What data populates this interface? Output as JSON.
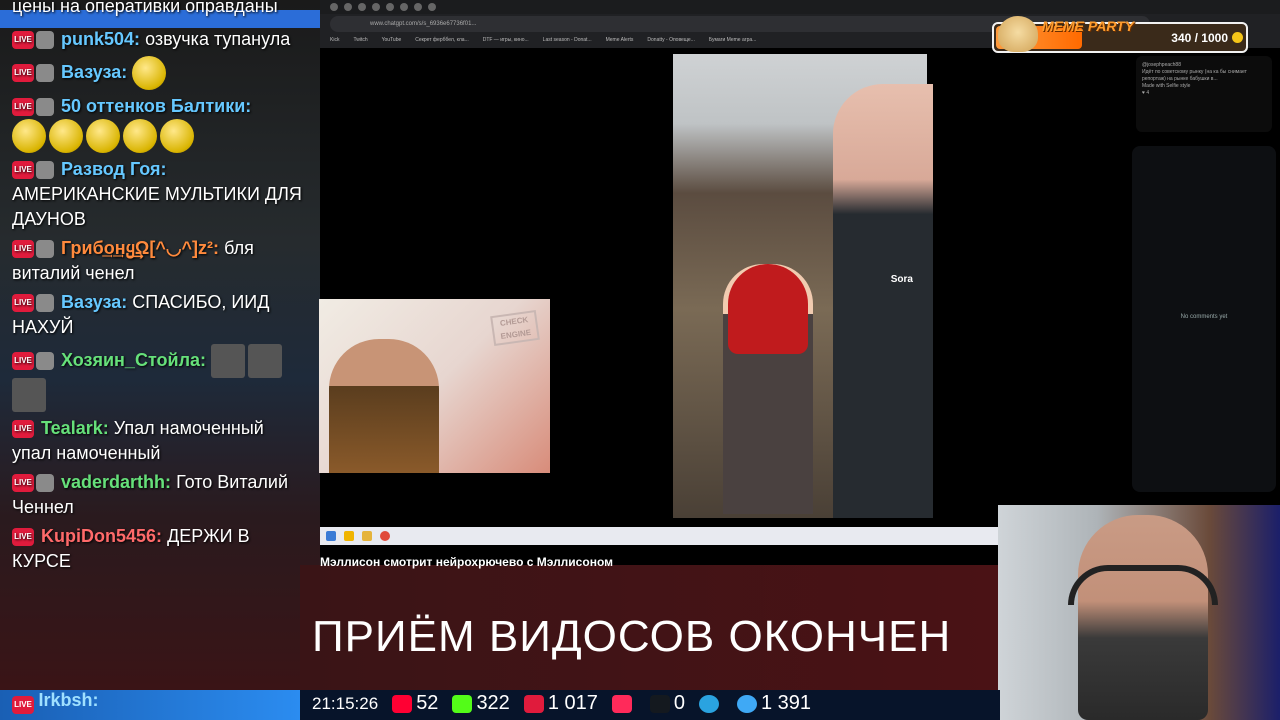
{
  "chat": {
    "messages": [
      {
        "nick": "",
        "text": "цены на оперативки оправданы"
      },
      {
        "nick": "punk504:",
        "text": "озвучка тупанула",
        "color": "#66c8ff"
      },
      {
        "nick": "Вазуза:",
        "text": "",
        "color": "#66c8ff"
      },
      {
        "nick": "50 оттенков Балтики:",
        "text": "",
        "color": "#66c8ff"
      },
      {
        "nick": "Развод Гоя:",
        "text": "АМЕРИКАНСКИЕ МУЛЬТИКИ ДЛЯ ДАУНОВ",
        "color": "#66c8ff"
      },
      {
        "nick": "Гриб͢о͢͢нყ͢Ω[^◡^]z²:",
        "text": "бля виталий ченел",
        "color": "#ff8a3d"
      },
      {
        "nick": "Вазуза:",
        "text": "СПАСИБО, ИИД НАХУЙ",
        "color": "#66c8ff"
      },
      {
        "nick": "Хозяин_Стойла:",
        "text": "",
        "color": "#66e07a"
      },
      {
        "nick": "Tealark:",
        "text": "Упал намоченный упал намоченный",
        "color": "#66e07a"
      },
      {
        "nick": "vaderdarthh:",
        "text": "Гото Виталий Ченнел",
        "color": "#66e07a"
      },
      {
        "nick": "KupiDon5456:",
        "text": "ДЕРЖИ В КУРСЕ",
        "color": "#ff6a6a"
      },
      {
        "nick": "Irkbsh:",
        "text": "",
        "color": "#66c8ff"
      }
    ]
  },
  "browser": {
    "url": "www.chatgpt.com/s/s_6936e67736f01...",
    "bookmarks": [
      "Kick",
      "Twitch",
      "YouTube",
      "Секрет ферббел, кла...",
      "DTF — игры, кино...",
      "Last season - Donat...",
      "Meme Alerts",
      "Donatty - Оповеще...",
      "Бумаги Meme агра..."
    ]
  },
  "video": {
    "overlay_label": "Sora",
    "check_sign": "CHECK ENGINE"
  },
  "side_panel": {
    "comment_user": "@josephpeach88",
    "comment_text": "Идёт по советскому рынку (на ка бы снимает репортаж) на рынке бабушки в...",
    "comment_made_with": "Made with Selfie style",
    "comment_likes": "4",
    "no_comments": "No comments yet"
  },
  "caption": "Мэллисон смотрит нейрохрючево с Мэллисоном",
  "banner": "ПРИЁМ ВИДОСОВ ОКОНЧЕН",
  "meme_party": {
    "title": "MEME PARTY",
    "count": "340 / 1000",
    "progress": 0.34
  },
  "status_bar": {
    "time": "21:15:26",
    "youtube": "52",
    "kick": "322",
    "live": "1 017",
    "rutube": "0",
    "telegram": "",
    "viewers": "1 391"
  }
}
